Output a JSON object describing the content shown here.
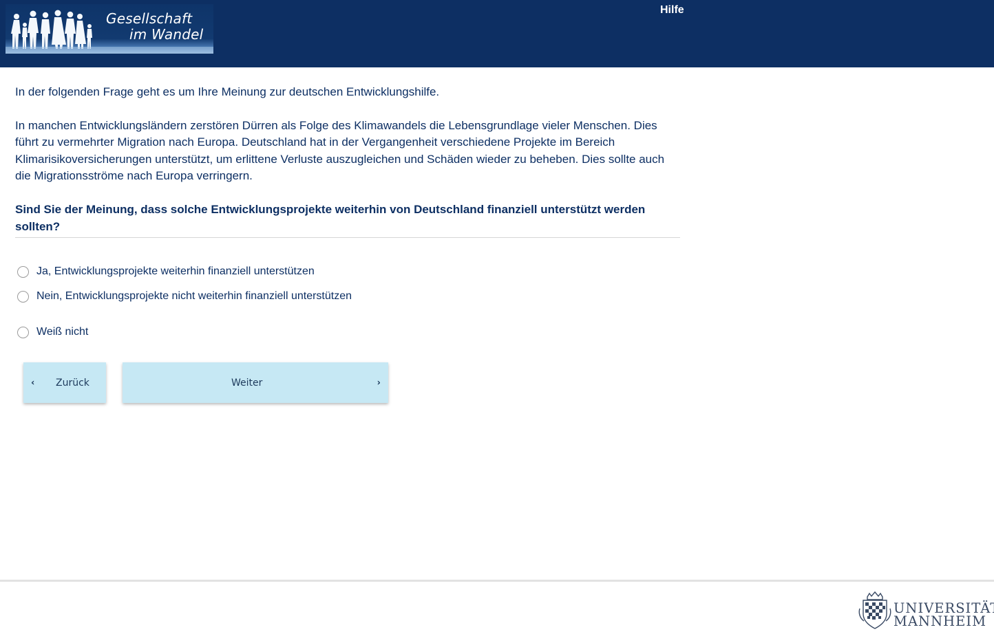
{
  "header": {
    "logo": {
      "line1": "Gesellschaft",
      "line2": "im Wandel"
    },
    "help_label": "Hilfe"
  },
  "main": {
    "intro": "In der folgenden Frage geht es um Ihre Meinung zur deutschen Entwicklungshilfe.",
    "paragraph": "In manchen Entwicklungsländern zerstören Dürren als Folge des Klimawandels die Lebensgrundlage vieler Menschen. Dies führt zu vermehrter Migration nach Europa. Deutschland hat in der Vergangenheit verschiedene Projekte im Bereich Klimarisikoversicherungen unterstützt, um erlittene Verluste auszugleichen und Schäden wieder zu beheben. Dies sollte auch die Migrationsströme nach Europa verringern.",
    "question": "Sind Sie der Meinung, dass solche Entwicklungsprojekte weiterhin von Deutschland finanziell unterstützt werden sollten?",
    "options": [
      {
        "label": "Ja, Entwicklungsprojekte weiterhin finanziell unterstützen",
        "selected": false
      },
      {
        "label": "Nein, Entwicklungsprojekte nicht weiterhin finanziell unterstützen",
        "selected": false
      },
      {
        "label": "Weiß nicht",
        "selected": false
      }
    ]
  },
  "navigation": {
    "back_label": "Zurück",
    "next_label": "Weiter"
  },
  "footer": {
    "university_line1": "UNIVERSITÄT",
    "university_line2": "MANNHEIM"
  },
  "colors": {
    "header_bg": "#0d2f63",
    "text": "#0d2f63",
    "button_bg": "#c6e8f4"
  }
}
